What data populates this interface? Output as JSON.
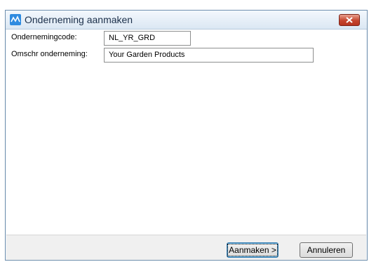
{
  "window": {
    "title": "Onderneming aanmaken",
    "close_icon": "close-icon"
  },
  "form": {
    "code_label": "Ondernemingcode:",
    "code_value": "NL_YR_GRD",
    "description_label": "Omschr onderneming:",
    "description_value": "Your Garden Products"
  },
  "footer": {
    "create_label": "Aanmaken >",
    "cancel_label": "Annuleren"
  }
}
